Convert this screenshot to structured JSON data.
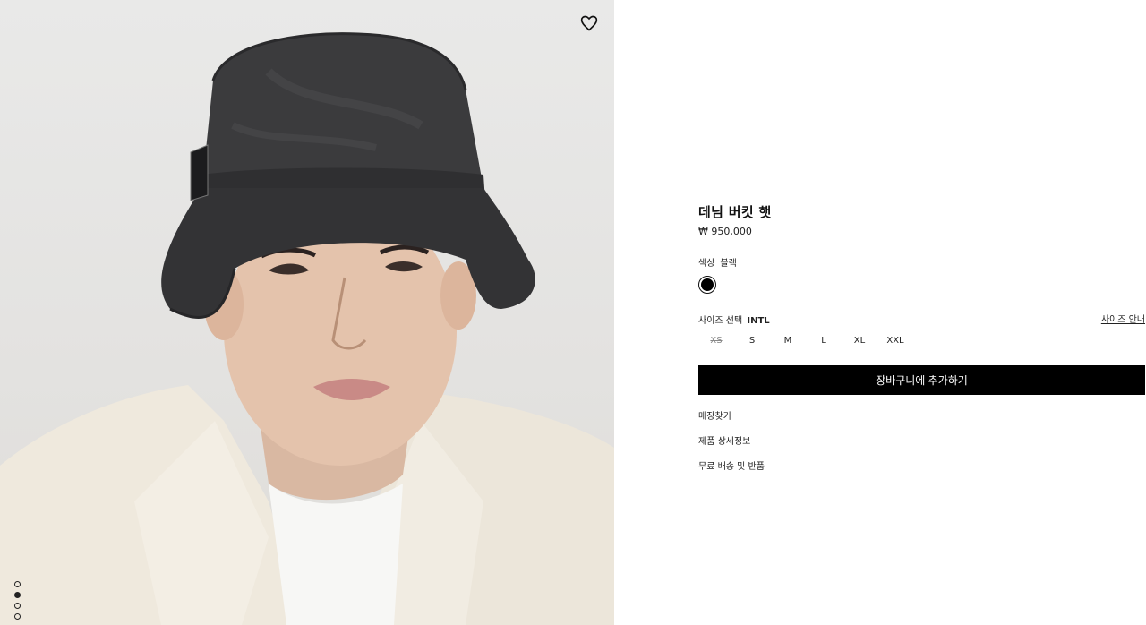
{
  "product": {
    "title": "데님 버킷 햇",
    "price": "₩ 950,000"
  },
  "color": {
    "label": "색상",
    "value": "블랙",
    "swatch_hex": "#000000"
  },
  "size": {
    "label": "사이즈 선택",
    "system": "INTL",
    "guide_label": "사이즈 안내",
    "options": [
      {
        "label": "XS",
        "available": false
      },
      {
        "label": "S",
        "available": true
      },
      {
        "label": "M",
        "available": true
      },
      {
        "label": "L",
        "available": true
      },
      {
        "label": "XL",
        "available": true
      },
      {
        "label": "XXL",
        "available": true
      }
    ]
  },
  "cart_button": "장바구니에 추가하기",
  "links": {
    "store_finder": "매장찾기",
    "product_details": "제품 상세정보",
    "shipping_returns": "무료 배송 및 반품"
  },
  "gallery": {
    "icon": "heart-icon",
    "active_slide": 2,
    "slide_count": 4
  }
}
